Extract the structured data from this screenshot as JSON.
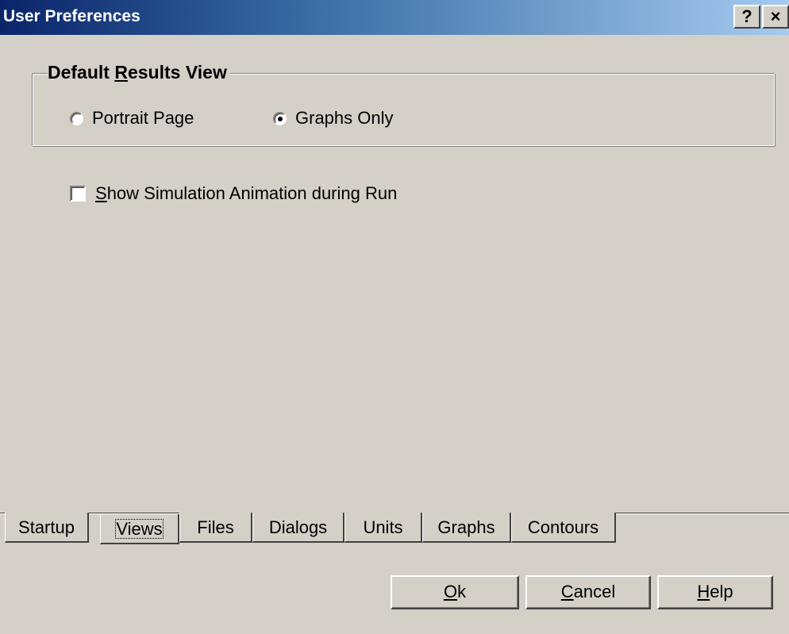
{
  "window": {
    "title": "User Preferences",
    "help_button": "?",
    "close_button": "×"
  },
  "group": {
    "legend_prefix": "Default ",
    "legend_accel": "R",
    "legend_suffix": "esults View"
  },
  "radios": {
    "portrait_label": "Portrait Page",
    "portrait_checked": false,
    "graphs_label": "Graphs Only",
    "graphs_checked": true
  },
  "checkbox": {
    "label_accel": "S",
    "label_rest": "how Simulation Animation during Run",
    "checked": false
  },
  "tabs": {
    "startup": "Startup",
    "views": "Views",
    "files": "Files",
    "dialogs": "Dialogs",
    "units": "Units",
    "graphs": "Graphs",
    "contours": "Contours",
    "active": "Views"
  },
  "buttons": {
    "ok_accel": "O",
    "ok_rest": "k",
    "cancel_accel": "C",
    "cancel_rest": "ancel",
    "help_accel": "H",
    "help_rest": "elp"
  },
  "colors": {
    "dialog_bg": "#d4d0c8",
    "titlebar_start": "#0a246a",
    "titlebar_end": "#a6caf0"
  }
}
